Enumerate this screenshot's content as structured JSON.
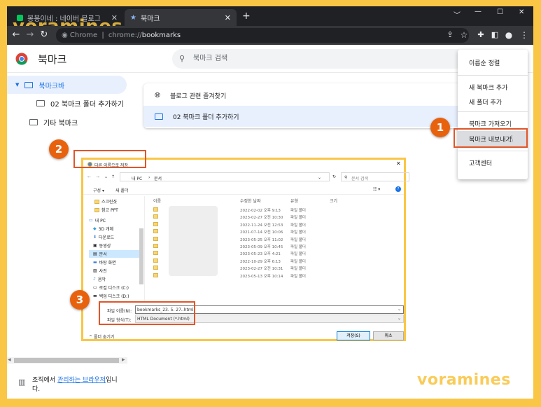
{
  "browser": {
    "tabs": [
      {
        "title": "봉봉이네 : 네이버 블로그",
        "close": "✕"
      },
      {
        "title": "북마크",
        "close": "✕"
      }
    ],
    "new_tab": "+",
    "url_host": "Chrome",
    "url_sep": "|",
    "url_scheme": "chrome://",
    "url_path": "bookmarks",
    "window_controls": [
      "﹀",
      "—",
      "☐",
      "✕"
    ]
  },
  "watermark": "voramines",
  "app": {
    "title": "북마크",
    "search_placeholder": "북마크 검색"
  },
  "sidebar": {
    "items": [
      {
        "label": "북마크바"
      },
      {
        "label": "02 북마크 폴더 추가하기"
      },
      {
        "label": "기타 북마크"
      }
    ]
  },
  "bookmarks": [
    {
      "label": "블로그 관련 즐겨찾기",
      "icon": "globe-icon"
    },
    {
      "label": "02 북마크 폴더 추가하기",
      "icon": "folder-icon"
    }
  ],
  "menu": {
    "items": [
      "이름순 정렬",
      "새 북마크 추가",
      "새 폴더 추가",
      "북마크 가져오기",
      "북마크 내보내기",
      "고객센터"
    ]
  },
  "badges": [
    "1",
    "2",
    "3"
  ],
  "dialog": {
    "title": "다른 이름으로 저장",
    "close": "✕",
    "path": [
      "내 PC",
      "문서"
    ],
    "search_placeholder": "문서 검색",
    "toolbar": [
      "구성 ▾",
      "새 폴더"
    ],
    "nav": [
      "스크린샷",
      "참고 PPT",
      "내 PC",
      "3D 개체",
      "다운로드",
      "동영상",
      "문서",
      "바탕 화면",
      "사진",
      "음악",
      "로컬 디스크 (C:)",
      "백업 디스크 (D:)"
    ],
    "columns": [
      "이름",
      "수정한 날짜",
      "유형",
      "크기"
    ],
    "rows": [
      {
        "date": "2022-02-02 오후 9:13",
        "type": "파일 폴더"
      },
      {
        "date": "2023-02-27 오전 10:30",
        "type": "파일 폴더"
      },
      {
        "date": "2022-11-24 오전 12:53",
        "type": "파일 폴더"
      },
      {
        "date": "2021-07-14 오전 10:06",
        "type": "파일 폴더"
      },
      {
        "date": "2023-05-25 오후 11:02",
        "type": "파일 폴더"
      },
      {
        "date": "2023-05-09 오후 10:45",
        "type": "파일 폴더"
      },
      {
        "date": "2023-05-23 오후 4:21",
        "type": "파일 폴더"
      },
      {
        "date": "2022-10-29 오후 6:13",
        "type": "파일 폴더"
      },
      {
        "date": "2023-02-27 오전 10:31",
        "type": "파일 폴더"
      },
      {
        "date": "2023-05-13 오후 10:14",
        "type": "파일 폴더"
      }
    ],
    "filename_label": "파일 이름(N):",
    "filename_value": "bookmarks_23. 5. 27..html",
    "filetype_label": "파일 형식(T):",
    "filetype_value": "HTML Document (*.html)",
    "hide_folders": "폴더 숨기기",
    "save": "저장(S)",
    "cancel": "취소"
  },
  "footer": {
    "prefix": "조직에서 ",
    "link": "관리하는 브라우저",
    "suffix": "입니다."
  },
  "colors": {
    "accent": "#1a73e8",
    "badge": "#e8620e",
    "highlight_box": "#e0562a",
    "frame": "#f9c646"
  }
}
